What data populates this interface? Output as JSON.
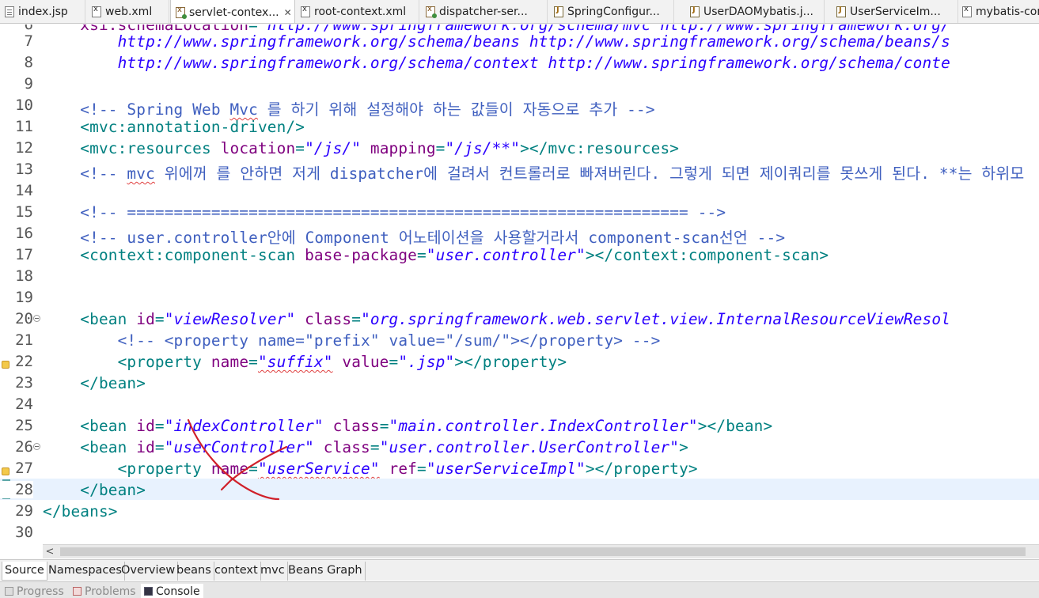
{
  "editor_tabs": [
    {
      "label": "index.jsp",
      "icon": "jsp-file-icon"
    },
    {
      "label": "web.xml",
      "icon": "xml-file-icon"
    },
    {
      "label": "servlet-contex...",
      "icon": "spring-bean-xml-icon",
      "active": true
    },
    {
      "label": "root-context.xml",
      "icon": "xml-file-icon"
    },
    {
      "label": "dispatcher-ser...",
      "icon": "spring-bean-xml-icon"
    },
    {
      "label": "SpringConfigur...",
      "icon": "java-file-icon"
    },
    {
      "label": "UserDAOMybatis.j...",
      "icon": "java-file-icon"
    },
    {
      "label": "UserServiceIm...",
      "icon": "java-file-icon"
    },
    {
      "label": "mybatis-con",
      "icon": "xml-file-icon"
    }
  ],
  "close_glyph": "✕",
  "lines": [
    {
      "num": "6",
      "text": "    xsi:schemaLocation=\"http://www.springframework.org/schema/mvc http://www.springframework.org/"
    },
    {
      "num": "7",
      "text": "        http://www.springframework.org/schema/beans http://www.springframework.org/schema/beans/s"
    },
    {
      "num": "8",
      "text": "        http://www.springframework.org/schema/context http://www.springframework.org/schema/conte"
    },
    {
      "num": "9",
      "text": ""
    },
    {
      "num": "10",
      "text": "    <!-- Spring Web Mvc 를 하기 위해 설정해야 하는 값들이 자동으로 추가 -->"
    },
    {
      "num": "11",
      "text": "    <mvc:annotation-driven/>"
    },
    {
      "num": "12",
      "text": "    <mvc:resources location=\"/js/\" mapping=\"/js/**\"></mvc:resources>"
    },
    {
      "num": "13",
      "text": "    <!-- mvc 위에꺼 를 안하면 저게 dispatcher에 걸려서 컨트롤러로 빠져버린다. 그렇게 되면 제이쿼리를 못쓰게 된다. **는 하위모"
    },
    {
      "num": "14",
      "text": ""
    },
    {
      "num": "15",
      "text": "    <!-- ============================================================ -->"
    },
    {
      "num": "16",
      "text": "    <!-- user.controller안에 Component 어노테이션을 사용할거라서 component-scan선언 -->"
    },
    {
      "num": "17",
      "text": "    <context:component-scan base-package=\"user.controller\"></context:component-scan>"
    },
    {
      "num": "18",
      "text": ""
    },
    {
      "num": "19",
      "text": ""
    },
    {
      "num": "20",
      "text": "    <bean id=\"viewResolver\" class=\"org.springframework.web.servlet.view.InternalResourceViewResol"
    },
    {
      "num": "21",
      "text": "        <!-- <property name=\"prefix\" value=\"/sum/\"></property> -->"
    },
    {
      "num": "22",
      "text": "        <property name=\"suffix\" value=\".jsp\"></property>"
    },
    {
      "num": "23",
      "text": "    </bean>"
    },
    {
      "num": "24",
      "text": ""
    },
    {
      "num": "25",
      "text": "    <bean id=\"indexController\" class=\"main.controller.IndexController\"></bean>"
    },
    {
      "num": "26",
      "text": "    <bean id=\"userController\" class=\"user.controller.UserController\">"
    },
    {
      "num": "27",
      "text": "        <property name=\"userService\" ref=\"userServiceImpl\"></property>"
    },
    {
      "num": "28",
      "text": "    </bean>"
    },
    {
      "num": "29",
      "text": "</beans>"
    },
    {
      "num": "30",
      "text": ""
    }
  ],
  "page_tabs": [
    "Source",
    "Namespaces",
    "Overview",
    "beans",
    "context",
    "mvc",
    "Beans Graph"
  ],
  "active_page_tab": "Source",
  "view_tabs": [
    {
      "label": "Progress",
      "icon": "progress-icon"
    },
    {
      "label": "Problems",
      "icon": "problems-icon"
    },
    {
      "label": "Console",
      "icon": "console-icon",
      "active": true
    }
  ],
  "scroll_left_glyph": "<",
  "colors": {
    "tag": "#008080",
    "attribute": "#7f007f",
    "attribute_value": "#2a00ff",
    "comment": "#3f5fbf",
    "current_line": "#e8f2fe",
    "annotation_ink": "#d0202a"
  }
}
